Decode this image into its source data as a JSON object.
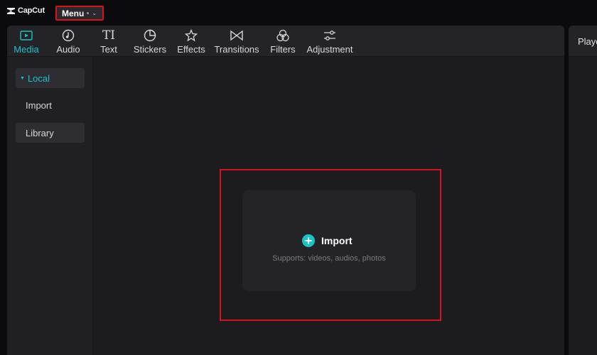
{
  "app": {
    "logo_text": "CapCut"
  },
  "titlebar": {
    "menu_label": "Menu"
  },
  "toolbar": {
    "items": [
      {
        "label": "Media",
        "icon": "media-icon",
        "active": true
      },
      {
        "label": "Audio",
        "icon": "audio-icon"
      },
      {
        "label": "Text",
        "icon": "text-icon",
        "glyph": "TI"
      },
      {
        "label": "Stickers",
        "icon": "stickers-icon"
      },
      {
        "label": "Effects",
        "icon": "effects-icon"
      },
      {
        "label": "Transitions",
        "icon": "transitions-icon"
      },
      {
        "label": "Filters",
        "icon": "filters-icon"
      },
      {
        "label": "Adjustment",
        "icon": "adjustment-icon"
      }
    ]
  },
  "sidebar": {
    "items": [
      {
        "label": "Local",
        "active": true
      },
      {
        "label": "Import"
      },
      {
        "label": "Library"
      }
    ]
  },
  "main": {
    "import_label": "Import",
    "supports_text": "Supports: videos, audios, photos"
  },
  "player": {
    "title": "Player"
  },
  "colors": {
    "accent": "#18c3cc",
    "highlight": "#d6141c",
    "background": "#1c1c1e"
  }
}
